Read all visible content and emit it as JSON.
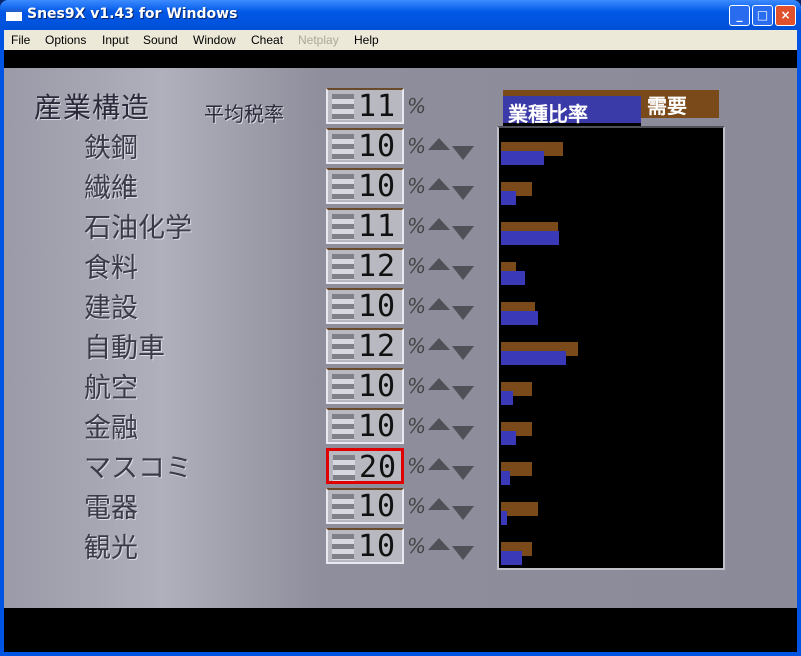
{
  "window": {
    "title": "Snes9X v1.43 for Windows",
    "buttons": [
      "_",
      "□",
      "×"
    ]
  },
  "menu": [
    {
      "label": "File"
    },
    {
      "label": "Options"
    },
    {
      "label": "Input"
    },
    {
      "label": "Sound"
    },
    {
      "label": "Window"
    },
    {
      "label": "Cheat"
    },
    {
      "label": "Netplay",
      "disabled": true
    },
    {
      "label": "Help"
    }
  ],
  "game": {
    "heading": "産業構造",
    "avg_label": "平均税率",
    "avg_value": "11",
    "percent": "%",
    "tabs": {
      "active": "業種比率",
      "inactive": "需要"
    },
    "colors": {
      "demand_bar": "#7a4a1a",
      "ratio_bar": "#3a3ab8",
      "selected_border": "#e00000"
    },
    "industries": [
      {
        "name": "鉄鋼",
        "rate": "10",
        "demand": 62,
        "ratio": 43
      },
      {
        "name": "繊維",
        "rate": "10",
        "demand": 31,
        "ratio": 15
      },
      {
        "name": "石油化学",
        "rate": "11",
        "demand": 57,
        "ratio": 58
      },
      {
        "name": "食料",
        "rate": "12",
        "demand": 15,
        "ratio": 24
      },
      {
        "name": "建設",
        "rate": "10",
        "demand": 34,
        "ratio": 37
      },
      {
        "name": "自動車",
        "rate": "12",
        "demand": 77,
        "ratio": 65
      },
      {
        "name": "航空",
        "rate": "10",
        "demand": 31,
        "ratio": 12
      },
      {
        "name": "金融",
        "rate": "10",
        "demand": 31,
        "ratio": 15
      },
      {
        "name": "マスコミ",
        "rate": "20",
        "demand": 31,
        "ratio": 9,
        "selected": true
      },
      {
        "name": "電器",
        "rate": "10",
        "demand": 37,
        "ratio": 6
      },
      {
        "name": "観光",
        "rate": "10",
        "demand": 31,
        "ratio": 21
      }
    ]
  }
}
